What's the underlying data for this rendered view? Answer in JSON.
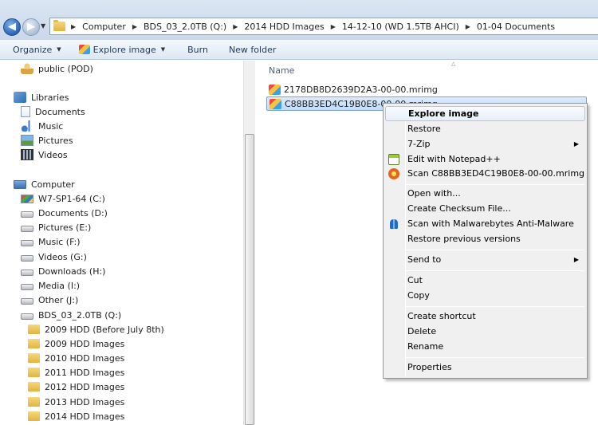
{
  "address_bar": {
    "crumbs": [
      "Computer",
      "BDS_03_2.0TB (Q:)",
      "2014 HDD Images",
      "14-12-10 (WD 1.5TB AHCI)",
      "01-04 Documents"
    ]
  },
  "toolbar": {
    "organize": "Organize",
    "explore_image": "Explore image",
    "burn": "Burn",
    "new_folder": "New folder"
  },
  "nav": {
    "public": "public (POD)",
    "libraries": "Libraries",
    "documents": "Documents",
    "music": "Music",
    "pictures": "Pictures",
    "videos": "Videos",
    "computer": "Computer",
    "drives": [
      "W7-SP1-64 (C:)",
      "Documents (D:)",
      "Pictures (E:)",
      "Music (F:)",
      "Videos (G:)",
      "Downloads (H:)",
      "Media (I:)",
      "Other (J:)",
      "BDS_03_2.0TB (Q:)"
    ],
    "folders": [
      "2009 HDD (Before July 8th)",
      "2009 HDD Images",
      "2010 HDD Images",
      "2011 HDD Images",
      "2012 HDD Images",
      "2013 HDD Images",
      "2014 HDD Images"
    ]
  },
  "files": {
    "column_name": "Name",
    "items": [
      "2178DB8D2639D2A3-00-00.mrimg",
      "C88BB3ED4C19B0E8-00-00.mrimg"
    ]
  },
  "context_menu": {
    "explore_image": "Explore image",
    "restore": "Restore",
    "zip": "7-Zip",
    "edit_notepad": "Edit with Notepad++",
    "scan": "Scan C88BB3ED4C19B0E8-00-00.mrimg",
    "open_with": "Open with...",
    "checksum": "Create Checksum File...",
    "malwarebytes": "Scan with Malwarebytes Anti-Malware",
    "restore_previous": "Restore previous versions",
    "send_to": "Send to",
    "cut": "Cut",
    "copy": "Copy",
    "create_shortcut": "Create shortcut",
    "delete": "Delete",
    "rename": "Rename",
    "properties": "Properties"
  }
}
